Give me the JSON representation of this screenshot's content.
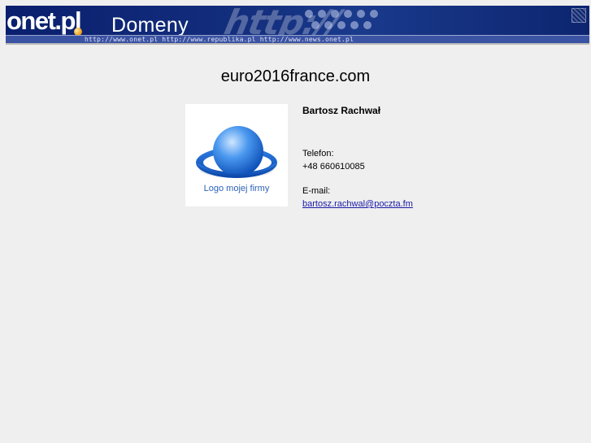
{
  "header": {
    "logo_text": "onet.pl",
    "section_title": "Domeny",
    "url_strip": "http://www.onet.pl   http://www.republika.pl   http://www.news.onet.pl",
    "decor_text": "http://",
    "brand_color": "#0a1f6e",
    "dot_color": "#f0a420"
  },
  "main": {
    "domain_name": "euro2016france.com"
  },
  "card": {
    "logo_caption": "Logo mojej firmy",
    "name": "Bartosz Rachwał",
    "phone_label": "Telefon:",
    "phone_value": "+48 660610085",
    "email_label": "E-mail:",
    "email_value": "bartosz.rachwal@poczta.fm",
    "email_href": "mailto:bartosz.rachwal@poczta.fm",
    "link_color": "#1a1aa6",
    "globe_color": "#1f6fd6"
  }
}
